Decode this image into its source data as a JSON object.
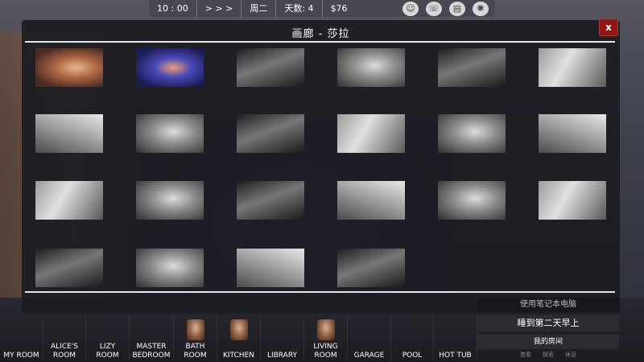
{
  "hud": {
    "time": "10 : 00",
    "skip": "> > >",
    "weekday": "周二",
    "days": "天数: 4",
    "money": "$76",
    "icons": [
      "profile-icon",
      "phone-icon",
      "journal-icon",
      "brain-icon"
    ]
  },
  "gallery": {
    "title": "画廊 - 莎拉",
    "close_label": "x",
    "thumbnail_count": 22
  },
  "side_panel": {
    "laptop_label": "使用笔记本电脑",
    "sleep_label": "睡到第二天早上",
    "room_label": "我的房间",
    "room_sub": [
      "查看",
      "探索",
      "休息"
    ]
  },
  "nav": {
    "items": [
      {
        "label": "MY ROOM",
        "portrait": false
      },
      {
        "label": "ALICE'S\nROOM",
        "portrait": false
      },
      {
        "label": "LIZY\nROOM",
        "portrait": false
      },
      {
        "label": "MASTER\nBEDROOM",
        "portrait": false
      },
      {
        "label": "BATH\nROOM",
        "portrait": true
      },
      {
        "label": "KITCHEN",
        "portrait": true
      },
      {
        "label": "LIBRARY",
        "portrait": false
      },
      {
        "label": "LIVING\nROOM",
        "portrait": true
      },
      {
        "label": "GARAGE",
        "portrait": false
      },
      {
        "label": "POOL",
        "portrait": false
      },
      {
        "label": "HOT TUB",
        "portrait": false
      }
    ]
  },
  "colors": {
    "close_button": "#8e1616",
    "modal_bg": "#1c1c22"
  }
}
